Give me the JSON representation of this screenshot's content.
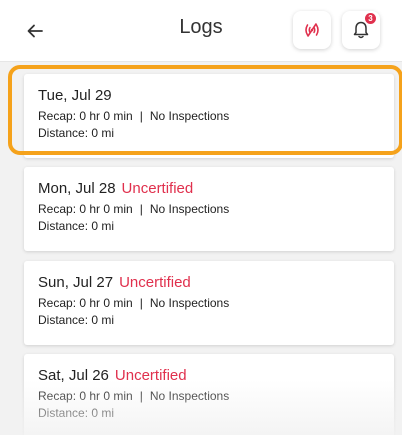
{
  "header": {
    "title": "Logs",
    "back_icon": "arrow-left-icon",
    "signal_icon": "signal-wave-icon",
    "bell_icon": "bell-icon",
    "notification_count": "3",
    "accent_color": "#e0304d"
  },
  "logs": [
    {
      "date": "Tue, Jul 29",
      "status": "",
      "recap": "Recap: 0 hr 0 min",
      "separator": "|",
      "inspections": "No Inspections",
      "distance": "Distance: 0 mi"
    },
    {
      "date": "Mon, Jul 28",
      "status": "Uncertified",
      "recap": "Recap: 0 hr 0 min",
      "separator": "|",
      "inspections": "No Inspections",
      "distance": "Distance: 0 mi"
    },
    {
      "date": "Sun, Jul 27",
      "status": "Uncertified",
      "recap": "Recap: 0 hr 0 min",
      "separator": "|",
      "inspections": "No Inspections",
      "distance": "Distance: 0 mi"
    },
    {
      "date": "Sat, Jul 26",
      "status": "Uncertified",
      "recap": "Recap: 0 hr 0 min",
      "separator": "|",
      "inspections": "No Inspections",
      "distance": "Distance: 0 mi"
    }
  ],
  "colors": {
    "status": "#e0304d",
    "highlight": "#f5a21b"
  }
}
